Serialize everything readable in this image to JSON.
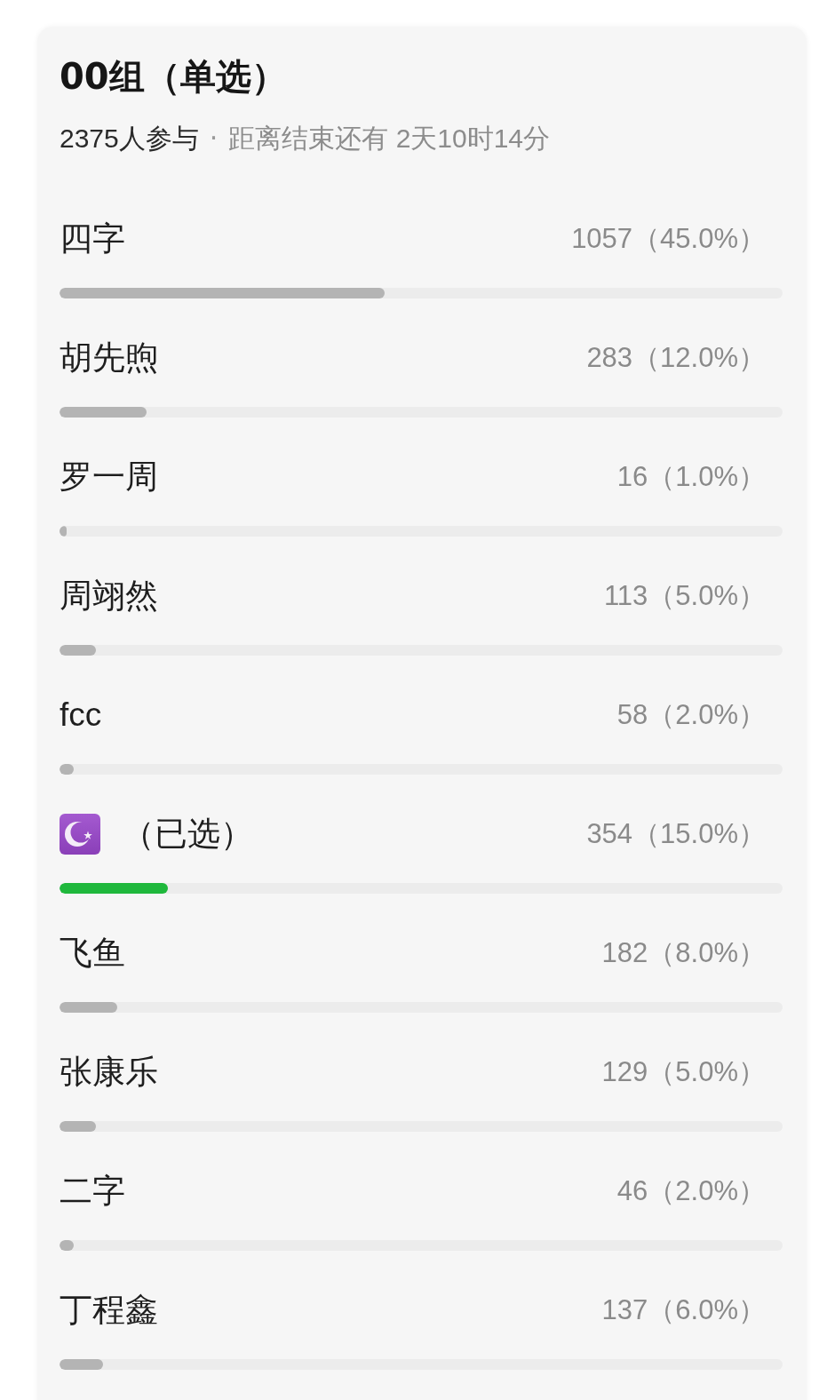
{
  "poll": {
    "title": "00组（单选）",
    "participants": "2375人参与",
    "separator": "·",
    "countdown": "距离结束还有 2天10时14分",
    "options": [
      {
        "kind": "text",
        "label": "四字",
        "count": "1057（45.0%）",
        "level": 0.45,
        "selected": false
      },
      {
        "kind": "text",
        "label": "胡先煦",
        "count": "283（12.0%）",
        "level": 0.12,
        "selected": false
      },
      {
        "kind": "text",
        "label": "罗一周",
        "count": "16（1.0%）",
        "level": 0.01,
        "selected": false
      },
      {
        "kind": "text",
        "label": "周翊然",
        "count": "113（5.0%）",
        "level": 0.05,
        "selected": false
      },
      {
        "kind": "text",
        "label": "fcc",
        "count": "58（2.0%）",
        "level": 0.02,
        "selected": false
      },
      {
        "kind": "icon",
        "label": "（已选）",
        "count": "354（15.0%）",
        "level": 0.15,
        "selected": true
      },
      {
        "kind": "text",
        "label": "飞鱼",
        "count": "182（8.0%）",
        "level": 0.08,
        "selected": false
      },
      {
        "kind": "text",
        "label": "张康乐",
        "count": "129（5.0%）",
        "level": 0.05,
        "selected": false
      },
      {
        "kind": "text",
        "label": "二字",
        "count": "46（2.0%）",
        "level": 0.02,
        "selected": false
      },
      {
        "kind": "text",
        "label": "丁程鑫",
        "count": "137（6.0%）",
        "level": 0.06,
        "selected": false
      }
    ]
  }
}
